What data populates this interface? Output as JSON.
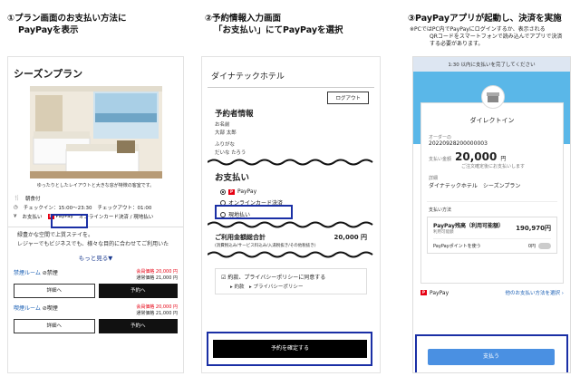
{
  "steps": [
    {
      "title_l1": "①プラン画面のお支払い方法に",
      "title_l2": "PayPayを表示"
    },
    {
      "title_l1": "②予約情報入力画面",
      "title_l2": "「お支払い」にてPayPayを選択"
    },
    {
      "title_l1": "③PayPayアプリが起動し、決済を実施",
      "note_l1": "※PCではPC内でPayPayにログインするか、表示される",
      "note_l2": "QRコードをスマートフォンで読み込んでアプリで決済",
      "note_l3": "する必要があります。"
    }
  ],
  "plan": {
    "title": "シーズンプラン",
    "photo_caption": "ゆったりとしたレイアウトと大きな窓が特徴の客室です。",
    "meal": "朝食付",
    "checkin": "チェックイン：15:00〜23:30",
    "checkout": "チェックアウト：01:00",
    "payment_label": "お支払い",
    "paypay": "PayPay",
    "other_payment": "オンラインカード決済 / 現地払い",
    "desc_l1": "緑豊かな空間で上質ステイを。",
    "desc_l2": "レジャーでもビジネスでも、様々な目的に合わせてご利用いた",
    "more": "もっと見る▼",
    "rooms": [
      {
        "name": "禁煙ルーム",
        "tag": "禁煙",
        "member_price": "会員価格 20,000 円",
        "normal_price": "通常価格 21,000 円",
        "detail": "詳細へ",
        "reserve": "予約へ"
      },
      {
        "name": "喫煙ルーム",
        "tag": "喫煙",
        "member_price": "会員価格 20,000 円",
        "normal_price": "通常価格 21,000 円",
        "detail": "詳細へ",
        "reserve": "予約へ"
      }
    ]
  },
  "booking": {
    "hotel": "ダイナテックホテル",
    "logout": "ログアウト",
    "booker_title": "予約者情報",
    "name_label": "お名前",
    "name_value": "大部 太郎",
    "kana_label": "ふりがな",
    "kana_value": "だいな たろう",
    "payment_title": "お支払い",
    "options": [
      "PayPay",
      "オンラインカード決済",
      "現地払い"
    ],
    "total_label": "ご利用金額総合計",
    "total_value": "20,000 円",
    "total_note": "(消費税込み/サービス料込み/入湯税抜き/その他税抜き)",
    "agree": "約款、プライバシーポリシーに同意する",
    "link1": "約款",
    "link2": "プライバシーポリシー",
    "confirm": "予約を確定する"
  },
  "paypay_app": {
    "topbar": "1:30 以内に支払いを完了してください",
    "store": "ダイレクトイン",
    "order_label": "オーダーの",
    "order_value": "20220928200000003",
    "amount_label": "支払い金額",
    "amount_value": "20,000",
    "amount_unit": "円",
    "tax_note": "ご注文確定後にお支払いします",
    "detail_label": "詳細",
    "detail_value": "ダイナテックホテル　シーズンプラン",
    "method_label": "支払い方法",
    "balance_label": "PayPay残高（利用可能額）",
    "balance_value": "190,970円",
    "balance_sub": "利用可能額",
    "points_label": "PayPayポイントを使う",
    "points_value": "0円",
    "brand": "PayPay",
    "other_methods": "他のお支払い方法を選択",
    "pay": "支払う"
  }
}
